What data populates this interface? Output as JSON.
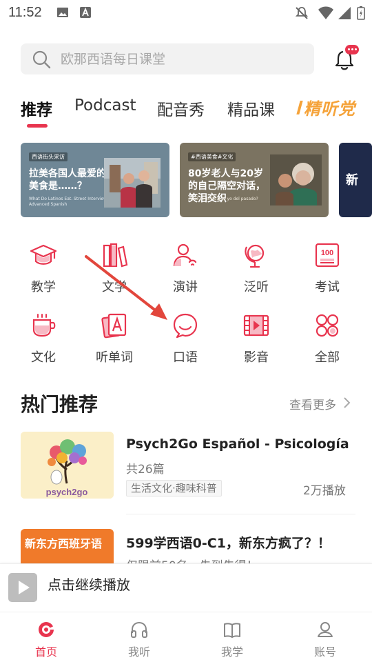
{
  "status_bar": {
    "time": "11:52"
  },
  "search": {
    "placeholder": "欧那西语每日课堂"
  },
  "tabs": [
    {
      "label": "推荐",
      "active": true
    },
    {
      "label": "Podcast"
    },
    {
      "label": "配音秀"
    },
    {
      "label": "精品课"
    },
    {
      "label": "精听党",
      "style": "brand"
    }
  ],
  "banners": [
    {
      "tag": "西语街头采访",
      "title": "拉美各国人最爱的美食是……？",
      "subtitle": "What Do Latinos Eat. Street Interview. Advanced Spanish"
    },
    {
      "tag": "#西语美食#文化",
      "title": "80岁老人与20岁的自己隔空对话，笑泪交织",
      "subtitle": "¿Qué le dirías a tu yo del pasado?"
    },
    {
      "title": "新"
    }
  ],
  "categories": [
    {
      "label": "教学",
      "icon": "graduation-cap-icon"
    },
    {
      "label": "文学",
      "icon": "books-icon"
    },
    {
      "label": "演讲",
      "icon": "speaker-icon"
    },
    {
      "label": "泛听",
      "icon": "globe-icon"
    },
    {
      "label": "考试",
      "icon": "exam-100-icon"
    },
    {
      "label": "文化",
      "icon": "cup-icon"
    },
    {
      "label": "听单词",
      "icon": "word-card-icon"
    },
    {
      "label": "口语",
      "icon": "chat-bubble-icon"
    },
    {
      "label": "影音",
      "icon": "film-icon"
    },
    {
      "label": "全部",
      "icon": "all-grid-icon"
    }
  ],
  "hot": {
    "title": "热门推荐",
    "see_more": "查看更多",
    "items": [
      {
        "title": "Psych2Go Español - Psicología P...",
        "count": "共26篇",
        "tag": "生活文化·趣味科普",
        "plays": "2万播放",
        "thumb_text": "psych2go"
      },
      {
        "title": "599学西语0-C1，新东方疯了？！",
        "subtitle": "仅限前50名，先到先得！",
        "thumb_text": "新东方西班牙语"
      }
    ]
  },
  "mini_player": {
    "label": "点击继续播放"
  },
  "bottom_nav": [
    {
      "label": "首页",
      "icon": "home-icon",
      "active": true
    },
    {
      "label": "我听",
      "icon": "headphones-icon"
    },
    {
      "label": "我学",
      "icon": "book-icon"
    },
    {
      "label": "账号",
      "icon": "account-icon"
    }
  ],
  "colors": {
    "accent": "#e8344e",
    "brand_tab": "#f5a33a"
  }
}
